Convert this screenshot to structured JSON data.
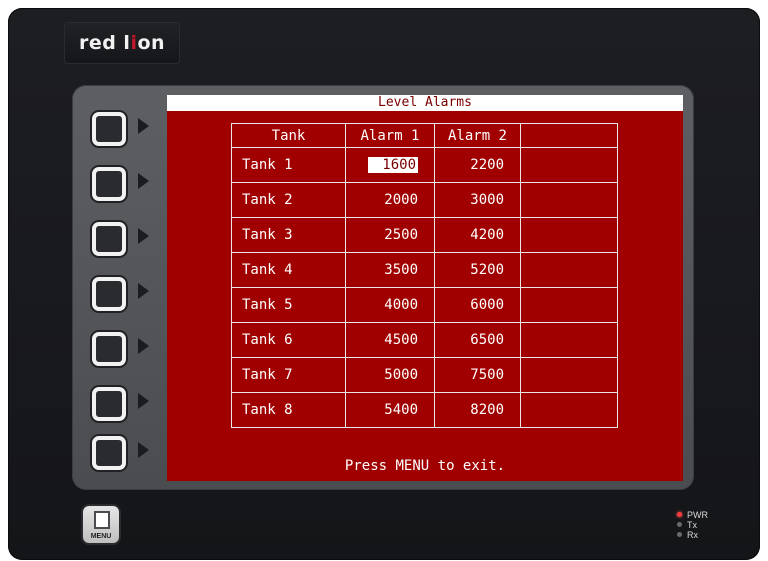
{
  "brand": {
    "pre": "red l",
    "i": "i",
    "post": "on"
  },
  "screen": {
    "title": "Level Alarms",
    "headers": [
      "Tank",
      "Alarm 1",
      "Alarm 2",
      ""
    ],
    "rows": [
      {
        "tank": "Tank 1",
        "alarm1": "1600",
        "alarm2": "2200"
      },
      {
        "tank": "Tank 2",
        "alarm1": "2000",
        "alarm2": "3000"
      },
      {
        "tank": "Tank 3",
        "alarm1": "2500",
        "alarm2": "4200"
      },
      {
        "tank": "Tank 4",
        "alarm1": "3500",
        "alarm2": "5200"
      },
      {
        "tank": "Tank 5",
        "alarm1": "4000",
        "alarm2": "6000"
      },
      {
        "tank": "Tank 6",
        "alarm1": "4500",
        "alarm2": "6500"
      },
      {
        "tank": "Tank 7",
        "alarm1": "5000",
        "alarm2": "7500"
      },
      {
        "tank": "Tank 8",
        "alarm1": "5400",
        "alarm2": "8200"
      }
    ],
    "footer": "Press MENU to exit."
  },
  "menu_key": {
    "label": "MENU"
  },
  "leds": [
    {
      "label": "PWR",
      "on": true
    },
    {
      "label": "Tx",
      "on": false
    },
    {
      "label": "Rx",
      "on": false
    }
  ],
  "colors": {
    "screen_bg": "#a00000",
    "bezel": "#55575b",
    "led_on": "#ff3b3b"
  }
}
